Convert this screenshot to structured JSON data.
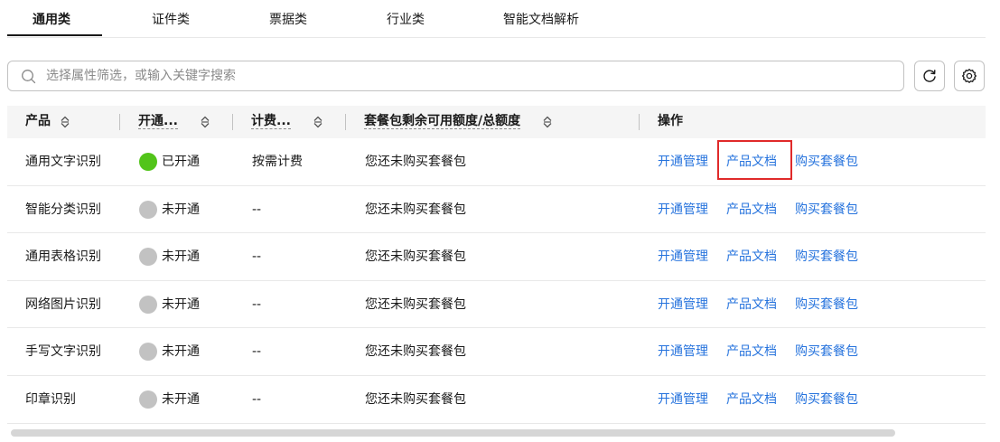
{
  "tabs": [
    {
      "label": "通用类",
      "active": true
    },
    {
      "label": "证件类",
      "active": false
    },
    {
      "label": "票据类",
      "active": false
    },
    {
      "label": "行业类",
      "active": false
    },
    {
      "label": "智能文档解析",
      "active": false
    }
  ],
  "search": {
    "placeholder": "选择属性筛选，或输入关键字搜索",
    "value": ""
  },
  "toolbar": {
    "refresh_icon": "refresh-icon",
    "settings_icon": "gear-icon"
  },
  "table": {
    "columns": [
      "产品",
      "开通...",
      "计费...",
      "套餐包剩余可用额度/总额度",
      "操作"
    ],
    "rows": [
      {
        "product": "通用文字识别",
        "status": "已开通",
        "status_on": true,
        "billing": "按需计费",
        "quota": "您还未购买套餐包",
        "actions": [
          "开通管理",
          "产品文档",
          "购买套餐包"
        ]
      },
      {
        "product": "智能分类识别",
        "status": "未开通",
        "status_on": false,
        "billing": "--",
        "quota": "您还未购买套餐包",
        "actions": [
          "开通管理",
          "产品文档",
          "购买套餐包"
        ]
      },
      {
        "product": "通用表格识别",
        "status": "未开通",
        "status_on": false,
        "billing": "--",
        "quota": "您还未购买套餐包",
        "actions": [
          "开通管理",
          "产品文档",
          "购买套餐包"
        ]
      },
      {
        "product": "网络图片识别",
        "status": "未开通",
        "status_on": false,
        "billing": "--",
        "quota": "您还未购买套餐包",
        "actions": [
          "开通管理",
          "产品文档",
          "购买套餐包"
        ]
      },
      {
        "product": "手写文字识别",
        "status": "未开通",
        "status_on": false,
        "billing": "--",
        "quota": "您还未购买套餐包",
        "actions": [
          "开通管理",
          "产品文档",
          "购买套餐包"
        ]
      },
      {
        "product": "印章识别",
        "status": "未开通",
        "status_on": false,
        "billing": "--",
        "quota": "您还未购买套餐包",
        "actions": [
          "开通管理",
          "产品文档",
          "购买套餐包"
        ]
      }
    ]
  },
  "colors": {
    "link": "#2673dd",
    "status_on": "#52c41a",
    "status_off": "#c2c2c2",
    "highlight": "#e02a2a"
  }
}
